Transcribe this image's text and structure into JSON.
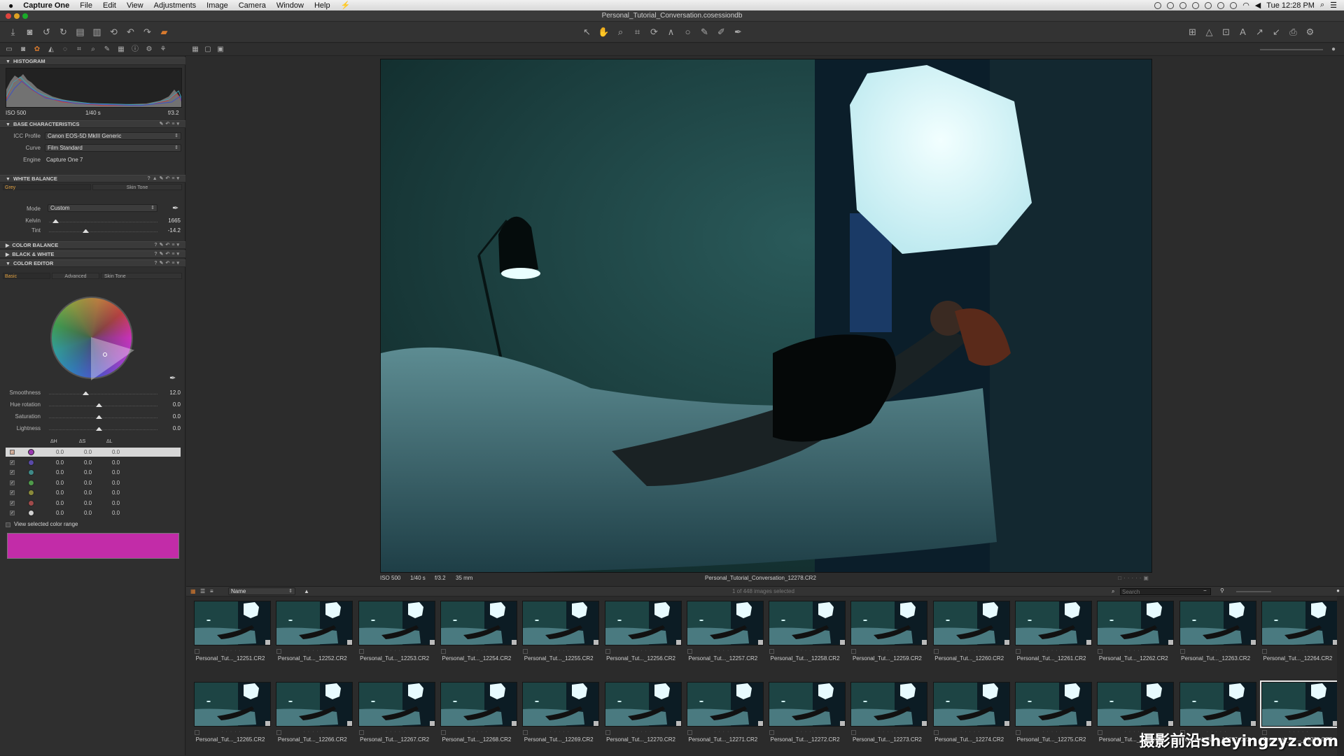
{
  "menubar": {
    "apple_icon": "apple-icon",
    "items": [
      "Capture One",
      "File",
      "Edit",
      "View",
      "Adjustments",
      "Image",
      "Camera",
      "Window",
      "Help"
    ],
    "clock": "Tue 12:28 PM"
  },
  "window": {
    "title": "Personal_Tutorial_Conversation.cosessiondb"
  },
  "histogram": {
    "section": "HISTOGRAM",
    "iso": "ISO 500",
    "shutter": "1/40 s",
    "aperture": "f/3.2"
  },
  "base": {
    "section": "BASE CHARACTERISTICS",
    "icc_label": "ICC Profile",
    "icc_value": "Canon EOS-5D MkIII Generic",
    "curve_label": "Curve",
    "curve_value": "Film Standard",
    "engine_label": "Engine",
    "engine_value": "Capture One 7"
  },
  "white_balance": {
    "section": "WHITE BALANCE",
    "tabs": [
      "Grey",
      "Skin Tone"
    ],
    "mode_label": "Mode",
    "mode_value": "Custom",
    "kelvin_label": "Kelvin",
    "kelvin_value": "1665",
    "tint_label": "Tint",
    "tint_value": "-14.2"
  },
  "collapsed_sections": [
    "COLOR BALANCE",
    "BLACK & WHITE"
  ],
  "color_editor": {
    "section": "COLOR EDITOR",
    "tabs": [
      "Basic",
      "Advanced",
      "Skin Tone"
    ],
    "sliders": [
      {
        "label": "Smoothness",
        "value": "12.0"
      },
      {
        "label": "Hue rotation",
        "value": "0.0"
      },
      {
        "label": "Saturation",
        "value": "0.0"
      },
      {
        "label": "Lightness",
        "value": "0.0"
      }
    ],
    "headers": [
      "ΔH",
      "ΔS",
      "ΔL"
    ],
    "rows": [
      {
        "color": "#9a3ab0",
        "h": "0.0",
        "s": "0.0",
        "l": "0.0"
      },
      {
        "color": "#5a4aa8",
        "h": "0.0",
        "s": "0.0",
        "l": "0.0"
      },
      {
        "color": "#3f8a88",
        "h": "0.0",
        "s": "0.0",
        "l": "0.0"
      },
      {
        "color": "#4f9a4a",
        "h": "0.0",
        "s": "0.0",
        "l": "0.0"
      },
      {
        "color": "#8a8a3a",
        "h": "0.0",
        "s": "0.0",
        "l": "0.0"
      },
      {
        "color": "#a04a4a",
        "h": "0.0",
        "s": "0.0",
        "l": "0.0"
      },
      {
        "color": "#d0d0d0",
        "h": "0.0",
        "s": "0.0",
        "l": "0.0"
      }
    ],
    "view_selected_label": "View selected color range",
    "range_color": "#c22ca8"
  },
  "viewer": {
    "iso": "ISO 500",
    "shutter": "1/40 s",
    "aperture": "f/3.2",
    "focal": "35 mm",
    "filename": "Personal_Tutorial_Conversation_12278.CR2"
  },
  "browser": {
    "sort_label": "Name",
    "count_text": "1 of 448 images selected",
    "search_placeholder": "Search",
    "row1": [
      "Personal_Tut..._12251.CR2",
      "Personal_Tut..._12252.CR2",
      "Personal_Tut..._12253.CR2",
      "Personal_Tut..._12254.CR2",
      "Personal_Tut..._12255.CR2",
      "Personal_Tut..._12256.CR2",
      "Personal_Tut..._12257.CR2",
      "Personal_Tut..._12258.CR2",
      "Personal_Tut..._12259.CR2",
      "Personal_Tut..._12260.CR2",
      "Personal_Tut..._12261.CR2",
      "Personal_Tut..._12262.CR2",
      "Personal_Tut..._12263.CR2",
      "Personal_Tut..._12264.CR2"
    ],
    "row2": [
      "Personal_Tut..._12265.CR2",
      "Personal_Tut..._12266.CR2",
      "Personal_Tut..._12267.CR2",
      "Personal_Tut..._12268.CR2",
      "Personal_Tut..._12269.CR2",
      "Personal_Tut..._12270.CR2",
      "Personal_Tut..._12271.CR2",
      "Personal_Tut..._12272.CR2",
      "Personal_Tut..._12273.CR2",
      "Personal_Tut..._12274.CR2",
      "Personal_Tut..._12275.CR2",
      "Personal_Tut..._12276.CR2",
      "Personal_Tut..._12277.CR2",
      "Personal_Tut..._12278.CR2"
    ],
    "selected": "Personal_Tut..._12278.CR2"
  },
  "watermark": "摄影前沿sheyingzyz.com"
}
